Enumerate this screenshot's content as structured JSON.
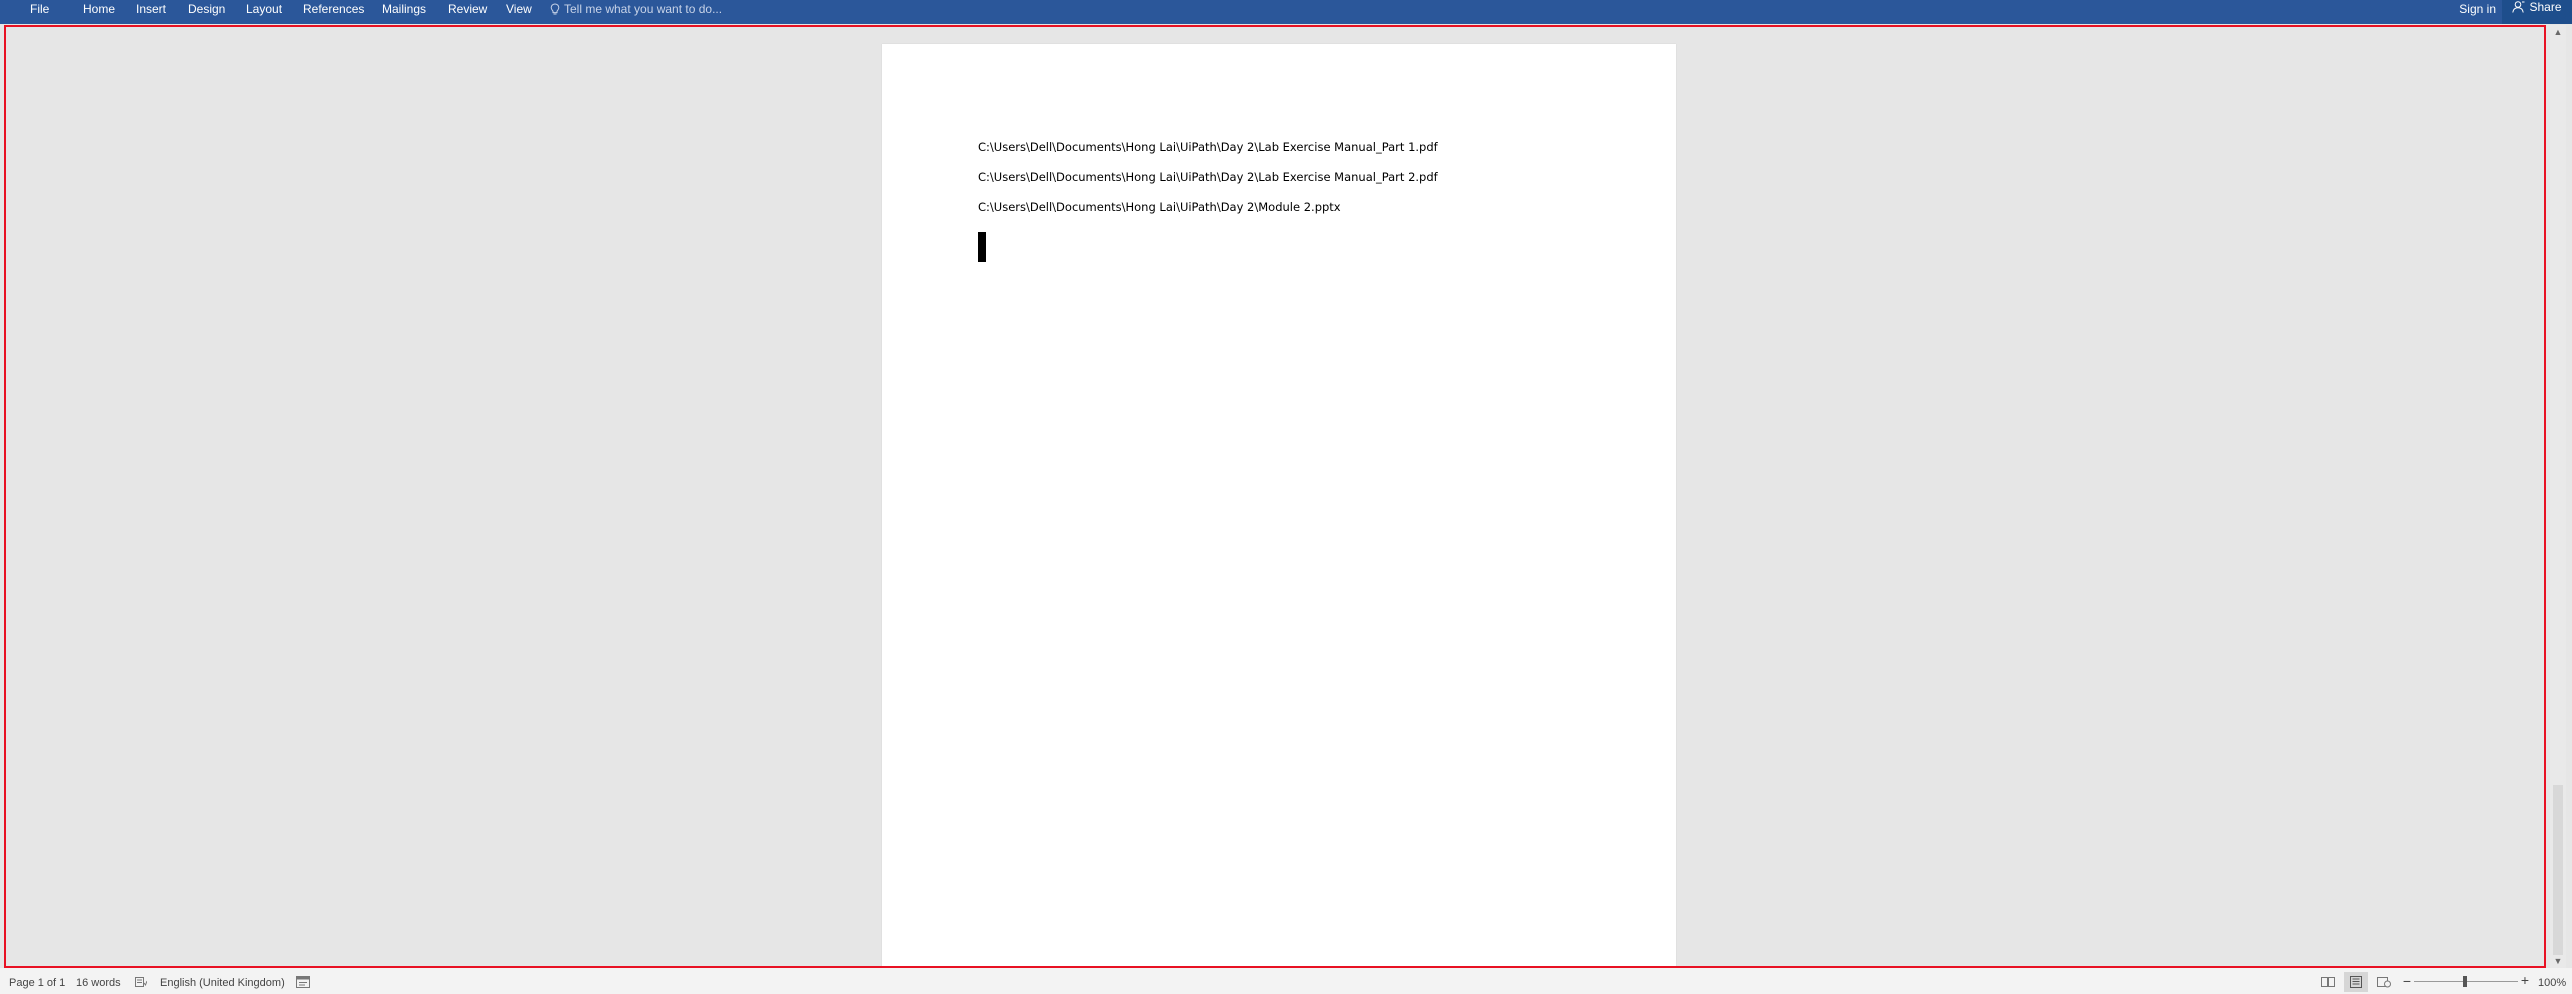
{
  "ribbon": {
    "tabs": [
      "File",
      "Home",
      "Insert",
      "Design",
      "Layout",
      "References",
      "Mailings",
      "Review",
      "View"
    ],
    "tell_me_placeholder": "Tell me what you want to do...",
    "sign_in": "Sign in",
    "share": "Share",
    "tell_me_icon": "lightbulb-icon",
    "share_icon": "person-icon"
  },
  "document": {
    "lines": [
      "C:\\Users\\Dell\\Documents\\Hong Lai\\UiPath\\Day 2\\Lab Exercise Manual_Part 1.pdf",
      "C:\\Users\\Dell\\Documents\\Hong Lai\\UiPath\\Day 2\\Lab Exercise Manual_Part 2.pdf",
      "C:\\Users\\Dell\\Documents\\Hong Lai\\UiPath\\Day 2\\Module 2.pptx"
    ]
  },
  "statusbar": {
    "page": "Page 1 of 1",
    "words": "16 words",
    "language": "English (United Kingdom)",
    "zoom": "100%",
    "zoom_minus": "−",
    "zoom_plus": "+"
  },
  "colors": {
    "ribbon": "#2b579a",
    "selection_border": "#e81123",
    "canvas": "#e6e6e6",
    "page": "#ffffff"
  }
}
